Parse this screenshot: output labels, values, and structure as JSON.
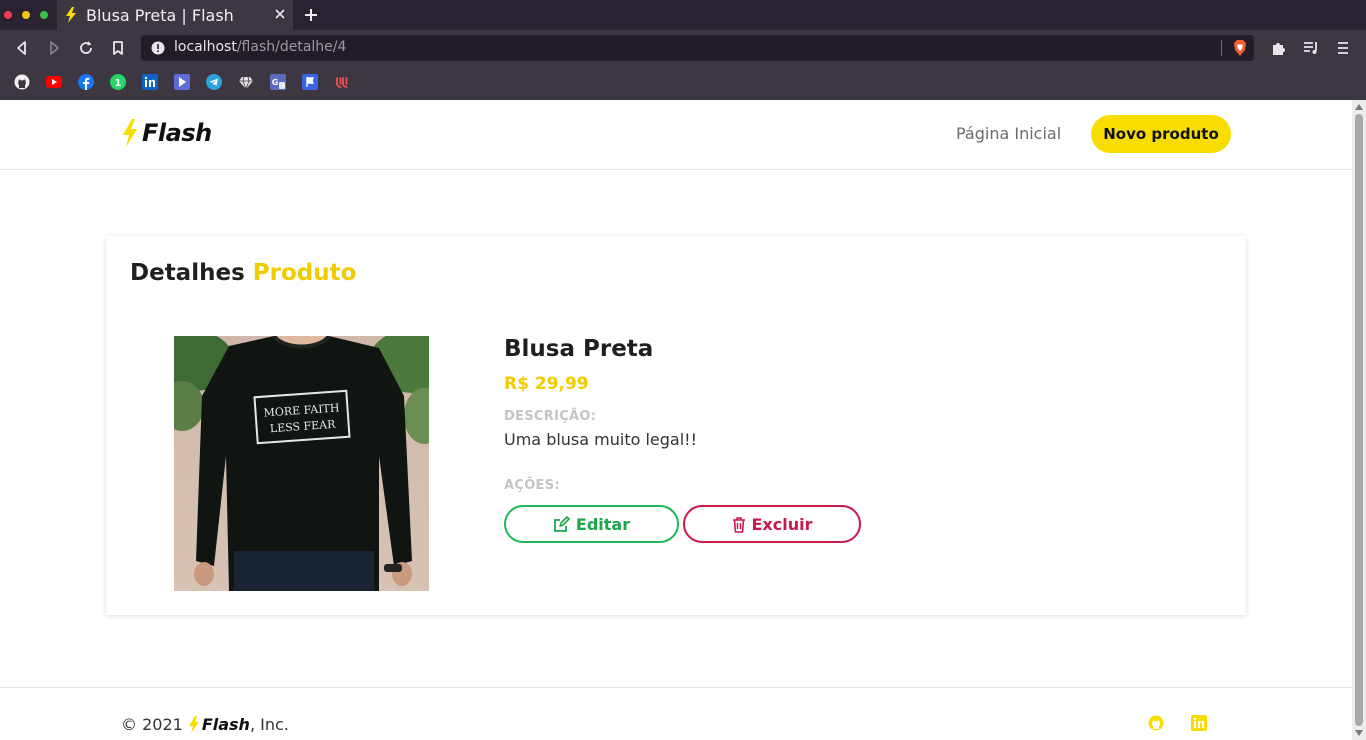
{
  "browser": {
    "tab_title": "Blusa Preta | Flash",
    "url_host": "localhost",
    "url_path": "/flash/detalhe/4",
    "window_dot_colors": [
      "#ed3b56",
      "#f5c518",
      "#36c046"
    ]
  },
  "bookmarks": [
    "github-icon",
    "youtube-icon",
    "facebook-icon",
    "whatsapp-icon",
    "linkedin-icon",
    "play-icon",
    "telegram-icon",
    "diamond-icon",
    "translate-icon",
    "flag-icon",
    "udemy-icon"
  ],
  "header": {
    "brand": "Flash",
    "nav_home": "Página Inicial",
    "nav_new": "Novo produto"
  },
  "card": {
    "title_part1": "Detalhes ",
    "title_part2": "Produto"
  },
  "product": {
    "name": "Blusa Preta",
    "price": "R$ 29,99",
    "description_label": "DESCRIÇÃO:",
    "description": "Uma blusa muito legal!!",
    "actions_label": "AÇÕES:",
    "edit_label": "Editar",
    "delete_label": "Excluir",
    "shirt_text_line1": "MORE FAITH",
    "shirt_text_line2": "LESS FEAR"
  },
  "footer": {
    "copy_prefix": "© 2021",
    "brand": "Flash",
    "copy_suffix": ", Inc."
  },
  "colors": {
    "accent_yellow": "#f7dd02",
    "edit_green": "#1db954",
    "delete_red": "#c8194a"
  }
}
